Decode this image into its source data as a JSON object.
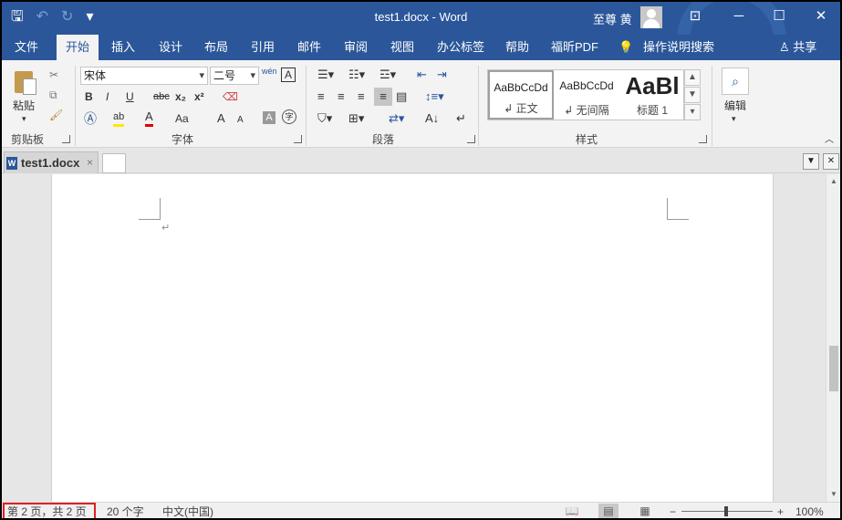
{
  "window": {
    "title": "test1.docx  -  Word",
    "user": "至尊 黄",
    "qat": {
      "save": "🖫",
      "undo": "↶",
      "redo": "↻",
      "customize": "▾"
    },
    "controls": {
      "ribbon_display": "⊡",
      "minimize": "─",
      "maximize": "☐",
      "close": "✕"
    }
  },
  "ribbon_tabs": [
    "文件",
    "开始",
    "插入",
    "设计",
    "布局",
    "引用",
    "邮件",
    "审阅",
    "视图",
    "办公标签",
    "帮助",
    "福昕PDF",
    "操作说明搜索"
  ],
  "active_tab": "开始",
  "share_label": "共享",
  "clipboard": {
    "label": "剪贴板",
    "paste": "粘贴"
  },
  "font": {
    "label": "字体",
    "name_value": "宋体",
    "size_value": "二号",
    "phonetic": "wén",
    "bold": "B",
    "italic": "I",
    "underline": "U",
    "strike": "abc",
    "subscript": "x₂",
    "superscript": "x²",
    "change_case": "Aa",
    "grow": "A",
    "shrink": "A"
  },
  "paragraph": {
    "label": "段落"
  },
  "styles": {
    "label": "样式",
    "items": [
      {
        "sample": "AaBbCcDd",
        "name": "↲ 正文"
      },
      {
        "sample": "AaBbCcDd",
        "name": "↲ 无间隔"
      },
      {
        "sample": "AaBl",
        "name": "标题 1"
      }
    ]
  },
  "editing": {
    "label": "编辑",
    "icon": "⌕"
  },
  "doc_tab": {
    "name": "test1.docx",
    "close": "×"
  },
  "document": {
    "paragraph_mark": "↵"
  },
  "status": {
    "page": "第 2 页，共 2 页",
    "words": "20 个字",
    "language": "中文(中国)",
    "zoom": "100%",
    "zoom_minus": "−",
    "zoom_plus": "+"
  }
}
